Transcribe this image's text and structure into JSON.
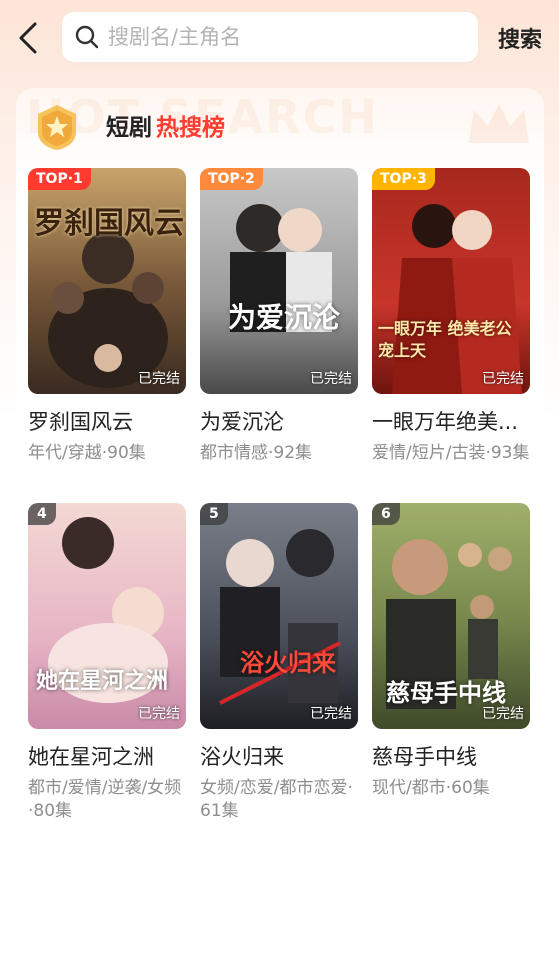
{
  "header": {
    "search_placeholder": "搜剧名/主角名",
    "search_button": "搜索"
  },
  "panel": {
    "watermark": "HOT SEARCH",
    "title_part1": "短剧",
    "title_part2": "热搜榜"
  },
  "colors": {
    "accent_red": "#ff3d2e",
    "top1": "#ff3b30",
    "top2": "#ff8a3c",
    "top3": "#ffb400"
  },
  "dramas": [
    {
      "rank": "TOP·1",
      "title": "罗刹国风云",
      "meta": "年代/穿越·90集",
      "status": "已完结",
      "poster_text": "罗刹国风云"
    },
    {
      "rank": "TOP·2",
      "title": "为爱沉沦",
      "meta": "都市情感·92集",
      "status": "已完结",
      "poster_text": "为爱沉沦"
    },
    {
      "rank": "TOP·3",
      "title": "一眼万年绝美...",
      "meta": "爱情/短片/古装·93集",
      "status": "已完结",
      "poster_text": "一眼万年 绝美老公宠上天"
    },
    {
      "rank": "4",
      "title": "她在星河之洲",
      "meta": "都市/爱情/逆袭/女频·80集",
      "status": "已完结",
      "poster_text": "她在星河之洲"
    },
    {
      "rank": "5",
      "title": "浴火归来",
      "meta": "女频/恋爱/都市恋爱·61集",
      "status": "已完结",
      "poster_text": "浴火归来"
    },
    {
      "rank": "6",
      "title": "慈母手中线",
      "meta": "现代/都市·60集",
      "status": "已完结",
      "poster_text": "慈母手中线"
    }
  ]
}
